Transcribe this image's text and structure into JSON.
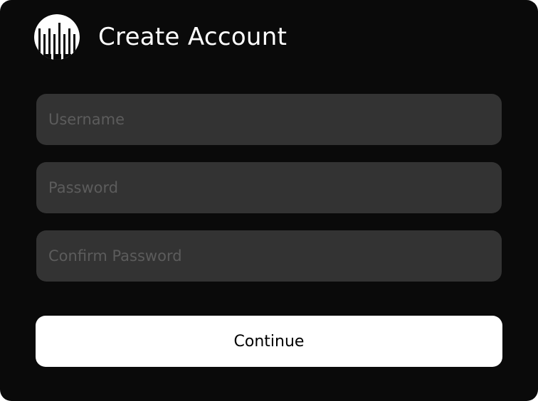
{
  "header": {
    "title": "Create Account",
    "logo_icon": "jellyfish-logo-icon"
  },
  "form": {
    "username": {
      "value": "",
      "placeholder": "Username"
    },
    "password": {
      "value": "",
      "placeholder": "Password"
    },
    "confirm_password": {
      "value": "",
      "placeholder": "Confirm Password"
    },
    "continue_label": "Continue"
  },
  "colors": {
    "background": "#0a0a0a",
    "field_background": "#333333",
    "placeholder": "#5c5c5c",
    "button_background": "#ffffff",
    "button_text": "#000000",
    "title_text": "#ffffff"
  }
}
